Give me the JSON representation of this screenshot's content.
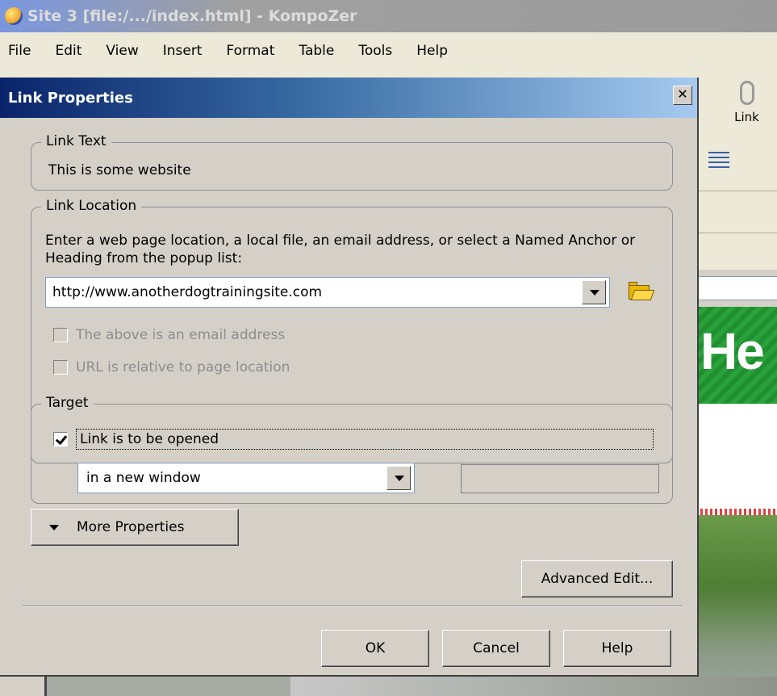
{
  "app": {
    "title": "Site 3 [file:/.../index.html] - KompoZer",
    "menu": [
      "File",
      "Edit",
      "View",
      "Insert",
      "Format",
      "Table",
      "Tools",
      "Help"
    ],
    "toolbar_link_label": "Link",
    "page_banner_text": "He"
  },
  "dialog": {
    "title": "Link Properties",
    "close_glyph": "✕",
    "link_text": {
      "legend": "Link Text",
      "value": "This is some website"
    },
    "link_location": {
      "legend": "Link Location",
      "description": "Enter a web page location, a local file, an email address, or select a Named Anchor or Heading from the popup list:",
      "url_value": "http://www.anotherdogtrainingsite.com",
      "email_checkbox_label": "The above is an email address",
      "email_checked": false,
      "relative_checkbox_label": "URL is relative to page location",
      "relative_checked": false
    },
    "target": {
      "legend": "Target",
      "open_checkbox_label": "Link is to be opened",
      "open_checked": true,
      "selected_option": "in a new window",
      "target_name_value": ""
    },
    "buttons": {
      "more_properties": "More Properties",
      "advanced_edit": "Advanced Edit...",
      "ok": "OK",
      "cancel": "Cancel",
      "help": "Help"
    },
    "icons": {
      "browse": "folder-open-icon",
      "dropdown": "chevron-down-icon"
    }
  },
  "colors": {
    "title_active": "#0a246a",
    "dialog_face": "#d4d0c8",
    "banner_green": "#2aa23b"
  }
}
